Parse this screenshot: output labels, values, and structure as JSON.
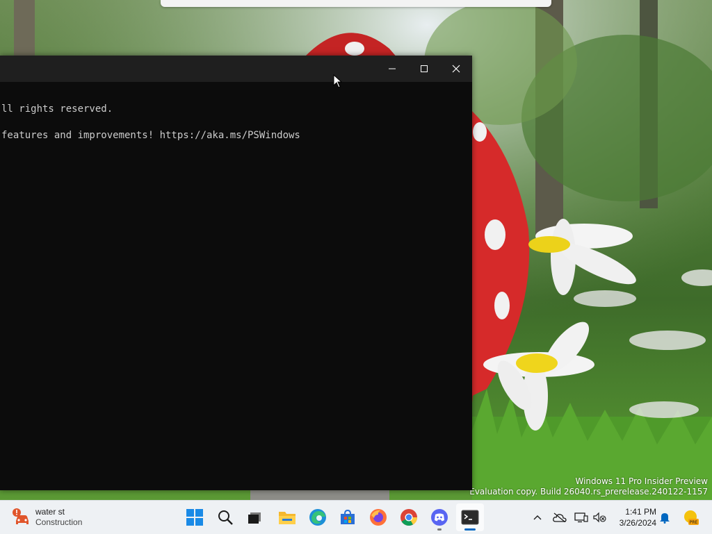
{
  "watermark": {
    "line1": "Windows 11 Pro Insider Preview",
    "line2": "Evaluation copy. Build 26040.rs_prerelease.240122-1157"
  },
  "terminal": {
    "lines": [
      "ll rights reserved.",
      "features and improvements! https://aka.ms/PSWindows"
    ],
    "buttons": {
      "minimize": "minimize",
      "maximize": "maximize",
      "close": "close"
    }
  },
  "taskbar": {
    "weather": {
      "title": "water st",
      "subtitle": "Construction",
      "icon": "traffic-alert-icon"
    },
    "apps": [
      {
        "name": "start",
        "icon": "windows-logo-icon"
      },
      {
        "name": "search",
        "icon": "search-icon"
      },
      {
        "name": "task-view",
        "icon": "task-view-icon"
      },
      {
        "name": "file-explorer",
        "icon": "folder-icon"
      },
      {
        "name": "edge",
        "icon": "edge-icon"
      },
      {
        "name": "microsoft-store",
        "icon": "store-icon"
      },
      {
        "name": "firefox",
        "icon": "firefox-icon"
      },
      {
        "name": "chrome",
        "icon": "chrome-icon"
      },
      {
        "name": "discord",
        "icon": "discord-icon"
      },
      {
        "name": "terminal",
        "icon": "terminal-icon",
        "active": true
      }
    ],
    "tray": {
      "chevron": "chevron-up-icon",
      "icons": [
        "cloud-offline-icon",
        "display-icon",
        "speaker-muted-icon",
        "notification-bell-icon",
        "insider-pre-icon"
      ],
      "time": "1:41 PM",
      "date": "3/26/2024"
    }
  },
  "colors": {
    "terminal_bg": "#0c0c0c",
    "titlebar_bg": "#1f1f1f",
    "taskbar_bg": "#eef1f4",
    "accent": "#0067c0"
  }
}
